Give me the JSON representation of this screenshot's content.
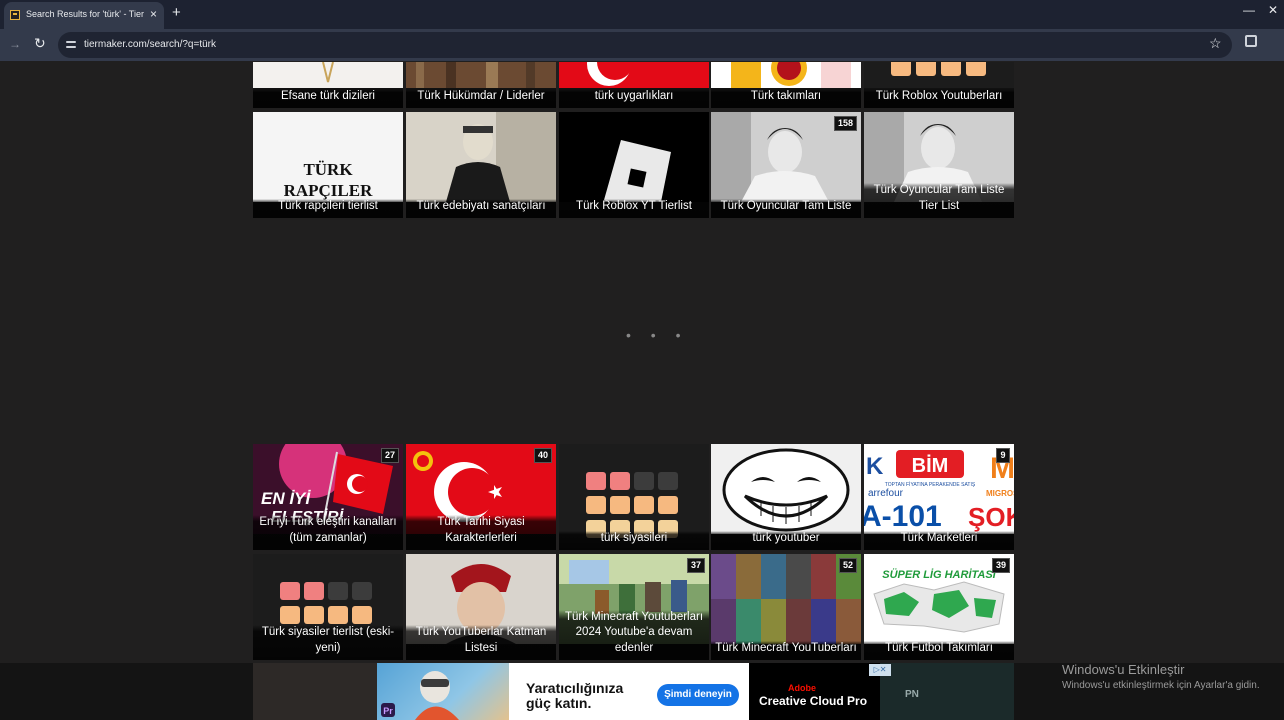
{
  "browser": {
    "tab_title": "Search Results for 'türk' - TierM",
    "tab_close": "×",
    "new_tab": "+",
    "url": "tiermaker.com/search/?q=türk",
    "star": "☆",
    "minimize": "—",
    "close": "✕"
  },
  "loader": "• • •",
  "tiles_top": [
    {
      "caption": "Efsane türk dizileri"
    },
    {
      "caption": "Türk Hükümdar / Liderler"
    },
    {
      "caption": "türk uygarlıkları"
    },
    {
      "caption": "Türk takımları"
    },
    {
      "caption": "Türk Roblox Youtuberları"
    }
  ],
  "tiles_row2": [
    {
      "caption": "Türk rapçileri tierlist",
      "thumb_text": "TÜRK RAPÇILER"
    },
    {
      "caption": "Türk edebiyatı sanatçıları"
    },
    {
      "caption": "Türk Roblox YT Tierlist"
    },
    {
      "caption": "Türk Oyuncular Tam Liste",
      "badge": "158"
    },
    {
      "caption": "Türk Oyuncular Tam Liste Tier List"
    }
  ],
  "tiles_row3": [
    {
      "caption": "En iyi Türk eleştiri kanalları (tüm zamanlar)",
      "badge": "27",
      "thumb_text": "EN İYİ ELEŞTİRİ"
    },
    {
      "caption": "Türk Tarihi Siyasi Karakterlerleri",
      "badge": "40"
    },
    {
      "caption": "türk siyasileri"
    },
    {
      "caption": "türk youtuber"
    },
    {
      "caption": "Türk Marketleri",
      "badge": "9",
      "thumb_text": {
        "bim": "BİM",
        "bim_sub": "TOPTAN FİYATINA PERAKENDE SATIŞ",
        "carrefour": "arrefour",
        "a101": "A-101",
        "sok": "ŞOK",
        "migros": "M",
        "migros_sub": "MIGROS"
      }
    }
  ],
  "tiles_row4": [
    {
      "caption": "Türk siyasiler tierlist (eski-yeni)"
    },
    {
      "caption": "Türk YouTuberlar Katman Listesi"
    },
    {
      "caption": "Türk Minecraft Youtuberları 2024 Youtube'a devam edenler",
      "badge": "37"
    },
    {
      "caption": "Türk Minecraft YouTuberları",
      "badge": "52"
    },
    {
      "caption": "Türk Futbol Takımları",
      "badge": "39",
      "thumb_text": "SÜPER LİG HARİTASI"
    }
  ],
  "ad": {
    "headline": "Yaratıcılığınıza güç katın.",
    "cta": "Şimdi deneyin",
    "brand_small": "Adobe",
    "brand": "Creative Cloud Pro",
    "app_tag": "Pr",
    "right_text": "PN"
  },
  "windows": {
    "title": "Windows'u Etkinleştir",
    "sub": "Windows'u etkinleştirmek için Ayarlar'a gidin."
  }
}
